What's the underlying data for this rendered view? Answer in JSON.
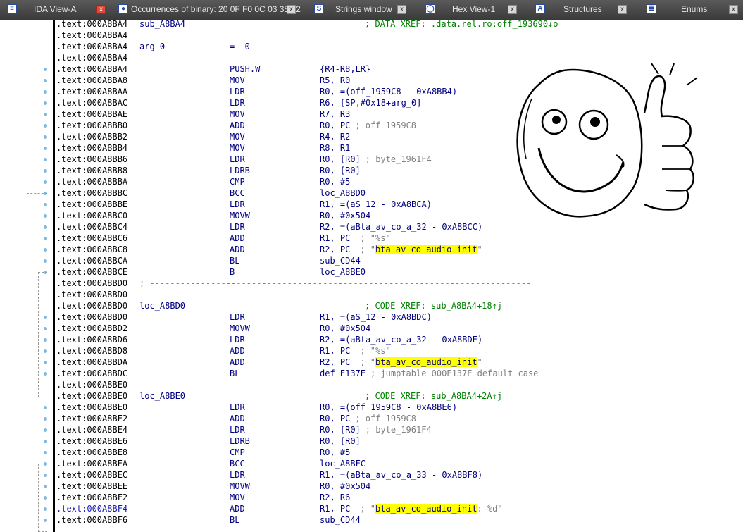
{
  "tabs": [
    {
      "label": "IDA View-A",
      "icon": "ida-view-icon",
      "active": true
    },
    {
      "label": "Occurrences of binary: 20 0F F0 0C 03 35 02",
      "icon": "search-results-icon",
      "active": false
    },
    {
      "label": "Strings window",
      "icon": "strings-icon",
      "active": false
    },
    {
      "label": "Hex View-1",
      "icon": "hex-view-icon",
      "active": false
    },
    {
      "label": "Structures",
      "icon": "structures-icon",
      "active": false
    },
    {
      "label": "Enums",
      "icon": "enums-icon",
      "active": false
    }
  ],
  "close_glyph": "x",
  "lines": [
    {
      "addr": ".text:000A8BA4",
      "label": "sub_A8BA4",
      "comment": "; DATA XREF: .data.rel.ro:off_193690↓o"
    },
    {
      "addr": ".text:000A8BA4"
    },
    {
      "addr": ".text:000A8BA4",
      "label": "arg_0",
      "extra": "=  0"
    },
    {
      "addr": ".text:000A8BA4"
    },
    {
      "addr": ".text:000A8BA4",
      "mn": "PUSH.W",
      "op": "{R4-R8,LR}"
    },
    {
      "addr": ".text:000A8BA8",
      "mn": "MOV",
      "op": "R5, R0"
    },
    {
      "addr": ".text:000A8BAA",
      "mn": "LDR",
      "op": "R0, =(off_1959C8 - 0xA8BB4)"
    },
    {
      "addr": ".text:000A8BAC",
      "mn": "LDR",
      "op": "R6, [SP,#0x18+arg_0]"
    },
    {
      "addr": ".text:000A8BAE",
      "mn": "MOV",
      "op": "R7, R3"
    },
    {
      "addr": ".text:000A8BB0",
      "mn": "ADD",
      "op": "R0, PC",
      "tail": "; off_1959C8"
    },
    {
      "addr": ".text:000A8BB2",
      "mn": "MOV",
      "op": "R4, R2"
    },
    {
      "addr": ".text:000A8BB4",
      "mn": "MOV",
      "op": "R8, R1"
    },
    {
      "addr": ".text:000A8BB6",
      "mn": "LDR",
      "op": "R0, [R0]",
      "tail": "; byte_1961F4"
    },
    {
      "addr": ".text:000A8BB8",
      "mn": "LDRB",
      "op": "R0, [R0]"
    },
    {
      "addr": ".text:000A8BBA",
      "mn": "CMP",
      "op": "R0, #5"
    },
    {
      "addr": ".text:000A8BBC",
      "mn": "BCC",
      "op": "loc_A8BD0"
    },
    {
      "addr": ".text:000A8BBE",
      "mn": "LDR",
      "op": "R1, =(aS_12 - 0xA8BCA)"
    },
    {
      "addr": ".text:000A8BC0",
      "mn": "MOVW",
      "op": "R0, #0x504"
    },
    {
      "addr": ".text:000A8BC4",
      "mn": "LDR",
      "op": "R2, =(aBta_av_co_a_32 - 0xA8BCC)"
    },
    {
      "addr": ".text:000A8BC6",
      "mn": "ADD",
      "op": "R1, PC",
      "str": "\"%s\""
    },
    {
      "addr": ".text:000A8BC8",
      "mn": "ADD",
      "op": "R2, PC",
      "str_hl": "bta_av_co_audio_init"
    },
    {
      "addr": ".text:000A8BCA",
      "mn": "BL",
      "op": "sub_CD44"
    },
    {
      "addr": ".text:000A8BCE",
      "mn": "B",
      "op": "loc_A8BE0"
    },
    {
      "addr": ".text:000A8BD0",
      "sep": "; ---------------------------------------------------------------------------"
    },
    {
      "addr": ".text:000A8BD0"
    },
    {
      "addr": ".text:000A8BD0",
      "label": "loc_A8BD0",
      "comment": "; CODE XREF: sub_A8BA4+18↑j"
    },
    {
      "addr": ".text:000A8BD0",
      "mn": "LDR",
      "op": "R1, =(aS_12 - 0xA8BDC)"
    },
    {
      "addr": ".text:000A8BD2",
      "mn": "MOVW",
      "op": "R0, #0x504"
    },
    {
      "addr": ".text:000A8BD6",
      "mn": "LDR",
      "op": "R2, =(aBta_av_co_a_32 - 0xA8BDE)"
    },
    {
      "addr": ".text:000A8BD8",
      "mn": "ADD",
      "op": "R1, PC",
      "str": "\"%s\""
    },
    {
      "addr": ".text:000A8BDA",
      "mn": "ADD",
      "op": "R2, PC",
      "str_hl": "bta_av_co_audio_init"
    },
    {
      "addr": ".text:000A8BDC",
      "mn": "BL",
      "op": "def_E137E",
      "tail": "; jumptable 000E137E default case"
    },
    {
      "addr": ".text:000A8BE0"
    },
    {
      "addr": ".text:000A8BE0",
      "label": "loc_A8BE0",
      "comment": "; CODE XREF: sub_A8BA4+2A↑j"
    },
    {
      "addr": ".text:000A8BE0",
      "mn": "LDR",
      "op": "R0, =(off_1959C8 - 0xA8BE6)"
    },
    {
      "addr": ".text:000A8BE2",
      "mn": "ADD",
      "op": "R0, PC",
      "tail": "; off_1959C8"
    },
    {
      "addr": ".text:000A8BE4",
      "mn": "LDR",
      "op": "R0, [R0]",
      "tail": "; byte_1961F4"
    },
    {
      "addr": ".text:000A8BE6",
      "mn": "LDRB",
      "op": "R0, [R0]"
    },
    {
      "addr": ".text:000A8BE8",
      "mn": "CMP",
      "op": "R0, #5"
    },
    {
      "addr": ".text:000A8BEA",
      "mn": "BCC",
      "op": "loc_A8BFC"
    },
    {
      "addr": ".text:000A8BEC",
      "mn": "LDR",
      "op": "R1, =(aBta_av_co_a_33 - 0xA8BF8)"
    },
    {
      "addr": ".text:000A8BEE",
      "mn": "MOVW",
      "op": "R0, #0x504"
    },
    {
      "addr": ".text:000A8BF2",
      "mn": "MOV",
      "op": "R2, R6"
    },
    {
      "addr": ".text:000A8BF4",
      "mn": "ADD",
      "op": "R1, PC",
      "str_hl": "bta_av_co_audio_init",
      "str_suffix": ": %d\"",
      "selected": true
    },
    {
      "addr": ".text:000A8BF6",
      "mn": "BL",
      "op": "sub_CD44"
    }
  ]
}
